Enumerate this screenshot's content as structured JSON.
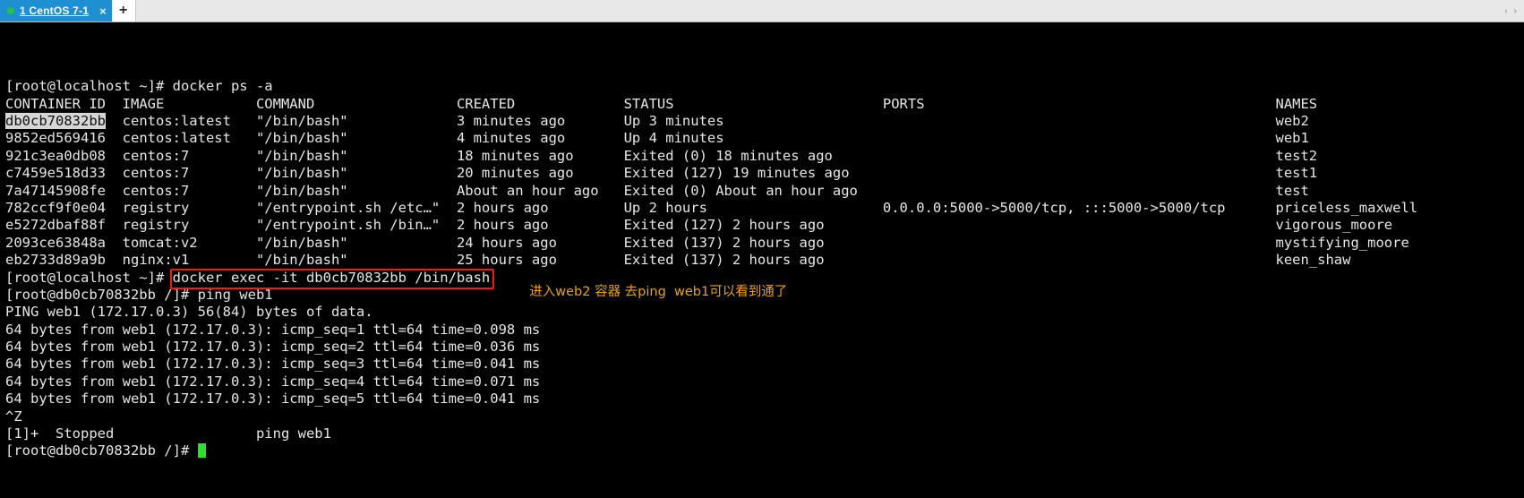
{
  "window": {
    "tab": {
      "label": "1 CentOS 7-1",
      "close_label": "×",
      "status_color": "#24c24b",
      "accent_color": "#1e90d2"
    },
    "new_tab_label": "+",
    "scroll_left_label": "‹",
    "scroll_right_label": "›"
  },
  "terminal": {
    "colors": {
      "background": "#000000",
      "foreground": "#e6e6e6",
      "selection_background": "#d6d6d6",
      "cursor": "#2ee02e",
      "annotation_box": "#f01b1b",
      "annotation_text": "#e8a317"
    },
    "prompt_host": "[root@localhost ~]# ",
    "prompt_container": "[root@db0cb70832bb /]# ",
    "command_ps": "docker ps -a",
    "command_exec": "docker exec -it db0cb70832bb /bin/bash",
    "command_ping": "ping web1",
    "annotation": "进入web2 容器 去ping  web1可以看到通了",
    "docker_ps": {
      "headers": {
        "container_id": "CONTAINER ID",
        "image": "IMAGE",
        "command": "COMMAND",
        "created": "CREATED",
        "status": "STATUS",
        "ports": "PORTS",
        "names": "NAMES"
      },
      "rows": [
        {
          "container_id": "db0cb70832bb",
          "image": "centos:latest",
          "command": "\"/bin/bash\"",
          "created": "3 minutes ago",
          "status": "Up 3 minutes",
          "ports": "",
          "names": "web2",
          "selected": true
        },
        {
          "container_id": "9852ed569416",
          "image": "centos:latest",
          "command": "\"/bin/bash\"",
          "created": "4 minutes ago",
          "status": "Up 4 minutes",
          "ports": "",
          "names": "web1",
          "selected": false
        },
        {
          "container_id": "921c3ea0db08",
          "image": "centos:7",
          "command": "\"/bin/bash\"",
          "created": "18 minutes ago",
          "status": "Exited (0) 18 minutes ago",
          "ports": "",
          "names": "test2",
          "selected": false
        },
        {
          "container_id": "c7459e518d33",
          "image": "centos:7",
          "command": "\"/bin/bash\"",
          "created": "20 minutes ago",
          "status": "Exited (127) 19 minutes ago",
          "ports": "",
          "names": "test1",
          "selected": false
        },
        {
          "container_id": "7a47145908fe",
          "image": "centos:7",
          "command": "\"/bin/bash\"",
          "created": "About an hour ago",
          "status": "Exited (0) About an hour ago",
          "ports": "",
          "names": "test",
          "selected": false
        },
        {
          "container_id": "782ccf9f0e04",
          "image": "registry",
          "command": "\"/entrypoint.sh /etc…\"",
          "created": "2 hours ago",
          "status": "Up 2 hours",
          "ports": "0.0.0.0:5000->5000/tcp, :::5000->5000/tcp",
          "names": "priceless_maxwell",
          "selected": false
        },
        {
          "container_id": "e5272dbaf88f",
          "image": "registry",
          "command": "\"/entrypoint.sh /bin…\"",
          "created": "2 hours ago",
          "status": "Exited (127) 2 hours ago",
          "ports": "",
          "names": "vigorous_moore",
          "selected": false
        },
        {
          "container_id": "2093ce63848a",
          "image": "tomcat:v2",
          "command": "\"/bin/bash\"",
          "created": "24 hours ago",
          "status": "Exited (137) 2 hours ago",
          "ports": "",
          "names": "mystifying_moore",
          "selected": false
        },
        {
          "container_id": "eb2733d89a9b",
          "image": "nginx:v1",
          "command": "\"/bin/bash\"",
          "created": "25 hours ago",
          "status": "Exited (137) 2 hours ago",
          "ports": "",
          "names": "keen_shaw",
          "selected": false
        }
      ]
    },
    "ping": {
      "header": "PING web1 (172.17.0.3) 56(84) bytes of data.",
      "replies": [
        "64 bytes from web1 (172.17.0.3): icmp_seq=1 ttl=64 time=0.098 ms",
        "64 bytes from web1 (172.17.0.3): icmp_seq=2 ttl=64 time=0.036 ms",
        "64 bytes from web1 (172.17.0.3): icmp_seq=3 ttl=64 time=0.041 ms",
        "64 bytes from web1 (172.17.0.3): icmp_seq=4 ttl=64 time=0.071 ms",
        "64 bytes from web1 (172.17.0.3): icmp_seq=5 ttl=64 time=0.041 ms"
      ],
      "suspend_char": "^Z",
      "job_status": "[1]+  Stopped                 ping web1"
    }
  }
}
